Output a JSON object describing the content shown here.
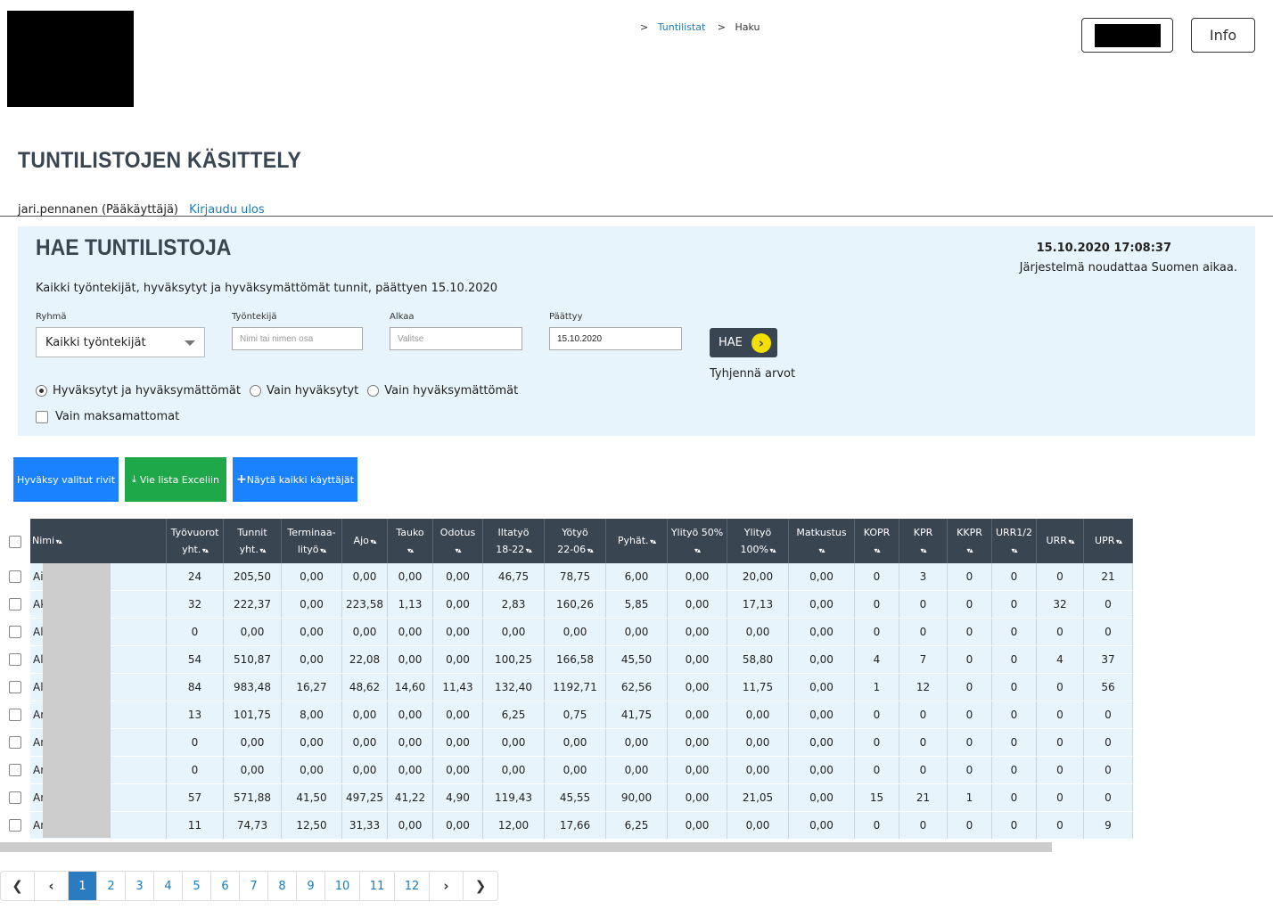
{
  "header": {
    "breadcrumb": [
      ">",
      "Tuntilistat",
      ">",
      "Haku"
    ],
    "info_label": "Info"
  },
  "page_title": "TUNTILISTOJEN KÄSITTELY",
  "user": {
    "name": "jari.pennanen (Pääkäyttäjä)",
    "logout": "Kirjaudu ulos"
  },
  "search": {
    "title": "HAE TUNTILISTOJA",
    "datetime": "15.10.2020 17:08:37",
    "timezone_note": "Järjestelmä noudattaa Suomen aikaa.",
    "summary": "Kaikki työntekijät, hyväksytyt ja hyväksymättömät tunnit, päättyen 15.10.2020",
    "group_label": "Ryhmä",
    "group_value": "Kaikki työntekijät",
    "employee_label": "Työntekijä",
    "employee_placeholder": "Nimi tai nimen osa",
    "start_label": "Alkaa",
    "start_placeholder": "Valitse",
    "end_label": "Päättyy",
    "end_value": "15.10.2020",
    "search_button": "HAE",
    "clear_label": "Tyhjennä arvot",
    "radio_options": [
      "Hyväksytyt ja hyväksymättömät",
      "Vain hyväksytyt",
      "Vain hyväksymättömät"
    ],
    "selected_radio": 0,
    "unpaid_label": "Vain maksamattomat"
  },
  "actions": {
    "approve": "Hyväksy valitut rivit",
    "excel": "Vie lista Exceliin",
    "show_all": "Näytä kaikki käyttäjät"
  },
  "table": {
    "columns": [
      [
        "Nimi"
      ],
      [
        "Työvuorot",
        "yht."
      ],
      [
        "Tunnit",
        "yht."
      ],
      [
        "Terminaa-",
        "lityö"
      ],
      [
        "Ajo"
      ],
      [
        "Tauko"
      ],
      [
        "Odotus"
      ],
      [
        "Iltatyö",
        "18-22"
      ],
      [
        "Yötyö",
        "22-06"
      ],
      [
        "Pyhät."
      ],
      [
        "Ylityö 50%"
      ],
      [
        "Ylityö",
        "100%"
      ],
      [
        "Matkustus"
      ],
      [
        "KOPR"
      ],
      [
        "KPR"
      ],
      [
        "KKPR"
      ],
      [
        "URR1/2"
      ],
      [
        "URR"
      ],
      [
        "UPR"
      ]
    ],
    "rows": [
      [
        "Aig",
        "24",
        "205,50",
        "0,00",
        "0,00",
        "0,00",
        "0,00",
        "46,75",
        "78,75",
        "6,00",
        "0,00",
        "20,00",
        "0,00",
        "0",
        "3",
        "0",
        "0",
        "0",
        "21"
      ],
      [
        "Ak",
        "32",
        "222,37",
        "0,00",
        "223,58",
        "1,13",
        "0,00",
        "2,83",
        "160,26",
        "5,85",
        "0,00",
        "17,13",
        "0,00",
        "0",
        "0",
        "0",
        "0",
        "32",
        "0"
      ],
      [
        "Ale",
        "0",
        "0,00",
        "0,00",
        "0,00",
        "0,00",
        "0,00",
        "0,00",
        "0,00",
        "0,00",
        "0,00",
        "0,00",
        "0,00",
        "0",
        "0",
        "0",
        "0",
        "0",
        "0"
      ],
      [
        "All",
        "54",
        "510,87",
        "0,00",
        "22,08",
        "0,00",
        "0,00",
        "100,25",
        "166,58",
        "45,50",
        "0,00",
        "58,80",
        "0,00",
        "4",
        "7",
        "0",
        "0",
        "4",
        "37"
      ],
      [
        "Alv",
        "84",
        "983,48",
        "16,27",
        "48,62",
        "14,60",
        "11,43",
        "132,40",
        "1192,71",
        "62,56",
        "0,00",
        "11,75",
        "0,00",
        "1",
        "12",
        "0",
        "0",
        "0",
        "56"
      ],
      [
        "An",
        "13",
        "101,75",
        "8,00",
        "0,00",
        "0,00",
        "0,00",
        "6,25",
        "0,75",
        "41,75",
        "0,00",
        "0,00",
        "0,00",
        "0",
        "0",
        "0",
        "0",
        "0",
        "0"
      ],
      [
        "An",
        "0",
        "0,00",
        "0,00",
        "0,00",
        "0,00",
        "0,00",
        "0,00",
        "0,00",
        "0,00",
        "0,00",
        "0,00",
        "0,00",
        "0",
        "0",
        "0",
        "0",
        "0",
        "0"
      ],
      [
        "An",
        "0",
        "0,00",
        "0,00",
        "0,00",
        "0,00",
        "0,00",
        "0,00",
        "0,00",
        "0,00",
        "0,00",
        "0,00",
        "0,00",
        "0",
        "0",
        "0",
        "0",
        "0",
        "0"
      ],
      [
        "An",
        "57",
        "571,88",
        "41,50",
        "497,25",
        "41,22",
        "4,90",
        "119,43",
        "45,55",
        "90,00",
        "0,00",
        "21,05",
        "0,00",
        "15",
        "21",
        "1",
        "0",
        "0",
        "0"
      ],
      [
        "An",
        "11",
        "74,73",
        "12,50",
        "31,33",
        "0,00",
        "0,00",
        "12,00",
        "17,66",
        "6,25",
        "0,00",
        "0,00",
        "0,00",
        "0",
        "0",
        "0",
        "0",
        "0",
        "9"
      ]
    ]
  },
  "pagination": {
    "pages": [
      "1",
      "2",
      "3",
      "4",
      "5",
      "6",
      "7",
      "8",
      "9",
      "10",
      "11",
      "12"
    ],
    "active": "1"
  }
}
